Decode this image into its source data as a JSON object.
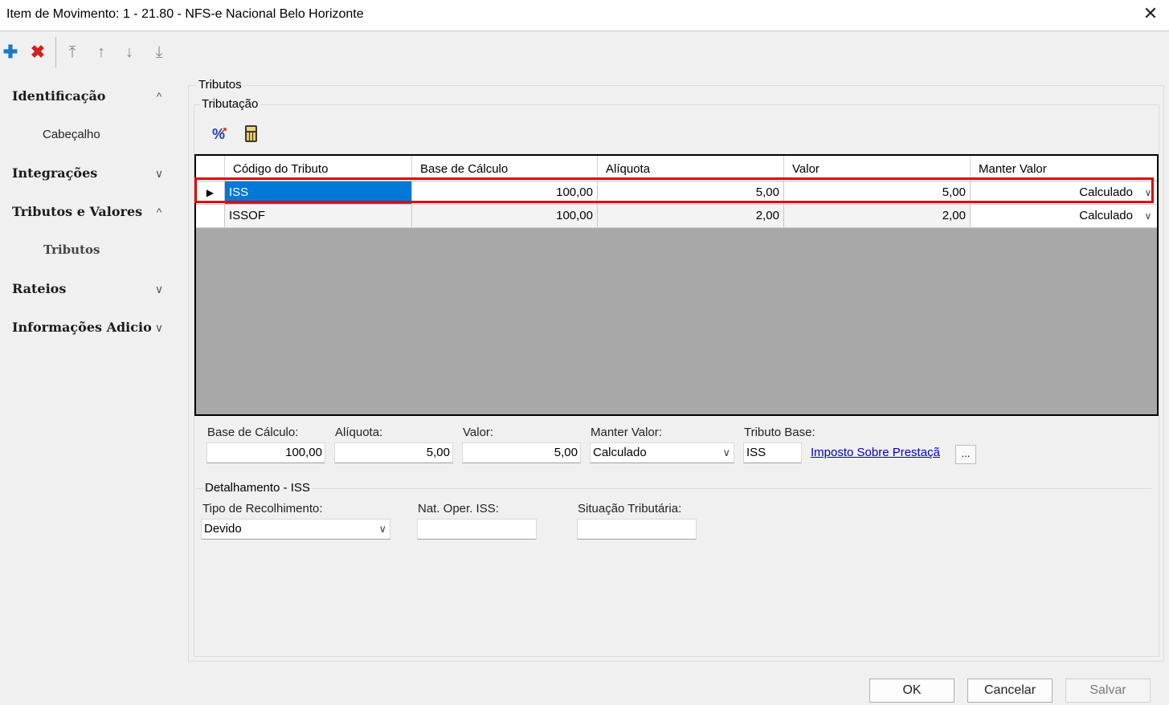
{
  "window": {
    "title": "Item de Movimento: 1 - 21.80 - NFS-e Nacional Belo Horizonte",
    "close_glyph": "✕"
  },
  "toolbar": {
    "add_glyph": "✚",
    "delete_glyph": "✖",
    "move_first_glyph": "⤒",
    "move_up_glyph": "↑",
    "move_down_glyph": "↓",
    "move_last_glyph": "⤓"
  },
  "sidebar": {
    "items": [
      {
        "label": "Identificação",
        "chevron": "^"
      },
      {
        "label": "Cabeçalho"
      },
      {
        "label": "Integrações",
        "chevron": "∨"
      },
      {
        "label": "Tributos e Valores",
        "chevron": "^"
      },
      {
        "label": "Tributos"
      },
      {
        "label": "Rateios",
        "chevron": "∨"
      },
      {
        "label": "Informações Adicio",
        "chevron": "∨"
      }
    ]
  },
  "group": {
    "tributos": "Tributos",
    "tributacao": "Tributação",
    "detalhamento": "Detalhamento - ISS"
  },
  "grid": {
    "headers": [
      "Código do Tributo",
      "Base de Cálculo",
      "Alíquota",
      "Valor",
      "Manter Valor"
    ],
    "rows": [
      {
        "indicator": "▶",
        "codigo": "ISS",
        "base": "100,00",
        "aliquota": "5,00",
        "valor": "5,00",
        "manter": "Calculado"
      },
      {
        "indicator": "",
        "codigo": "ISSOF",
        "base": "100,00",
        "aliquota": "2,00",
        "valor": "2,00",
        "manter": "Calculado"
      }
    ],
    "drop_glyph": "∨"
  },
  "fields": {
    "base_label": "Base de Cálculo:",
    "base_value": "100,00",
    "aliquota_label": "Alíquota:",
    "aliquota_value": "5,00",
    "valor_label": "Valor:",
    "valor_value": "5,00",
    "manter_label": "Manter Valor:",
    "manter_value": "Calculado",
    "tributo_base_label": "Tributo Base:",
    "tributo_base_value": "ISS",
    "tributo_base_link": "Imposto Sobre Prestaçã",
    "ellipsis": "...",
    "select_arrow": "∨"
  },
  "detalhe": {
    "tipo_label": "Tipo de Recolhimento:",
    "tipo_value": "Devido",
    "nat_label": "Nat. Oper. ISS:",
    "nat_value": "",
    "situacao_label": "Situação Tributária:",
    "situacao_value": ""
  },
  "buttons": {
    "ok": "OK",
    "cancel": "Cancelar",
    "save": "Salvar"
  }
}
